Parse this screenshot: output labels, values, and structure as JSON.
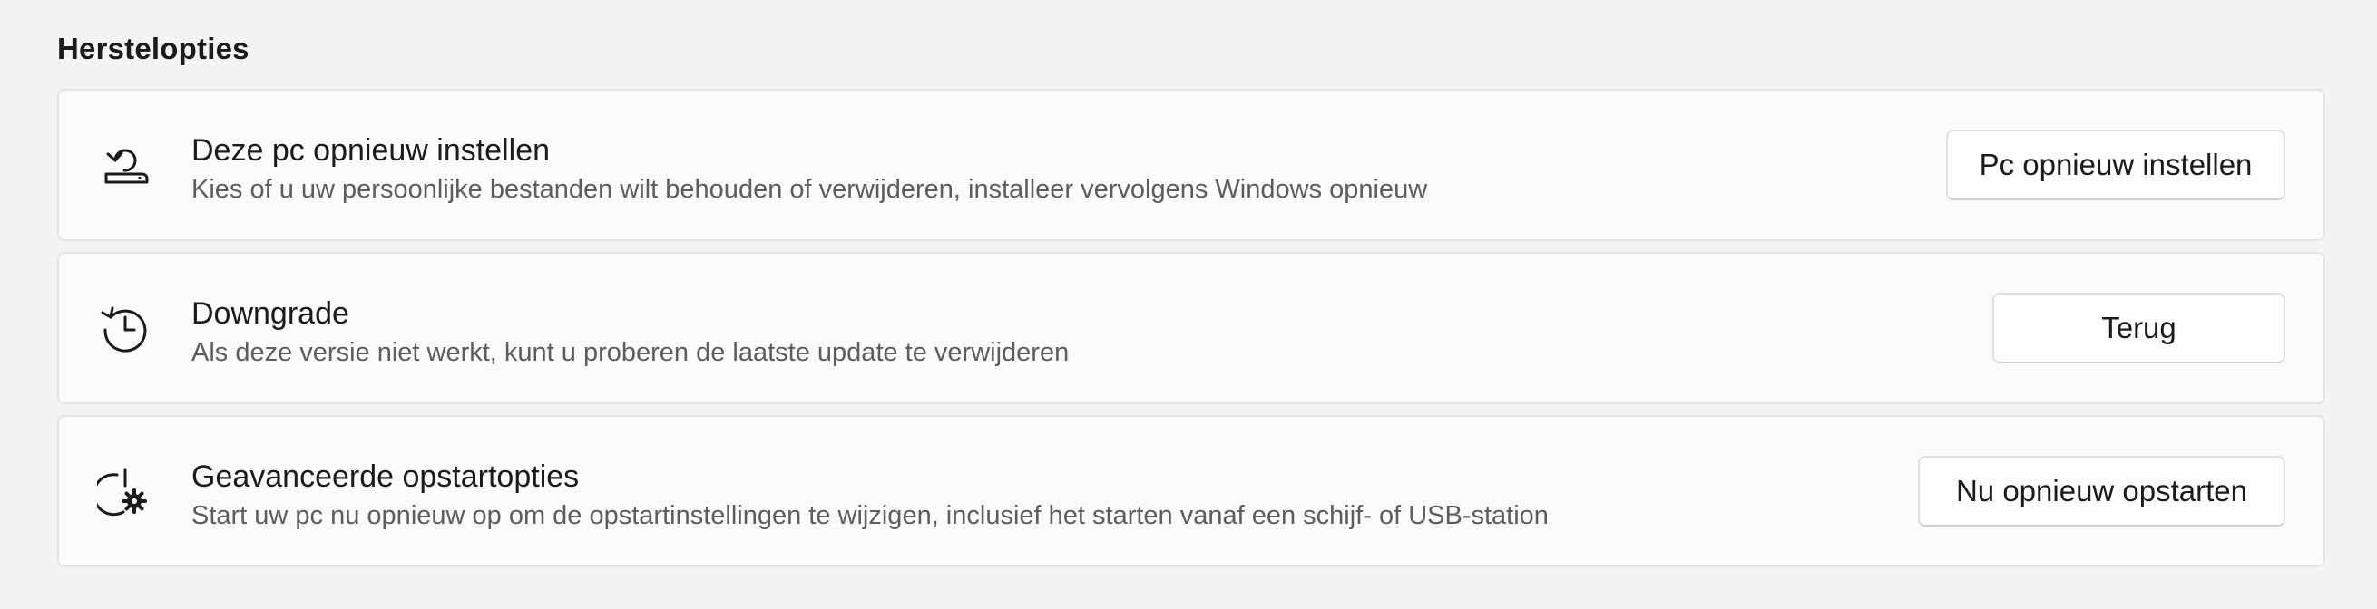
{
  "section": {
    "title": "Herstelopties"
  },
  "options": [
    {
      "title": "Deze pc opnieuw instellen",
      "description": "Kies of u uw persoonlijke bestanden wilt behouden of verwijderen, installeer vervolgens Windows opnieuw",
      "button_label": "Pc opnieuw instellen",
      "icon": "reset-pc-icon"
    },
    {
      "title": "Downgrade",
      "description": "Als deze versie niet werkt, kunt u proberen de laatste update te verwijderen",
      "button_label": "Terug",
      "icon": "history-icon"
    },
    {
      "title": "Geavanceerde opstartopties",
      "description": "Start uw pc nu opnieuw op om de opstartinstellingen te wijzigen, inclusief het starten vanaf een schijf- of USB-station",
      "button_label": "Nu opnieuw opstarten",
      "icon": "advanced-startup-icon"
    }
  ]
}
